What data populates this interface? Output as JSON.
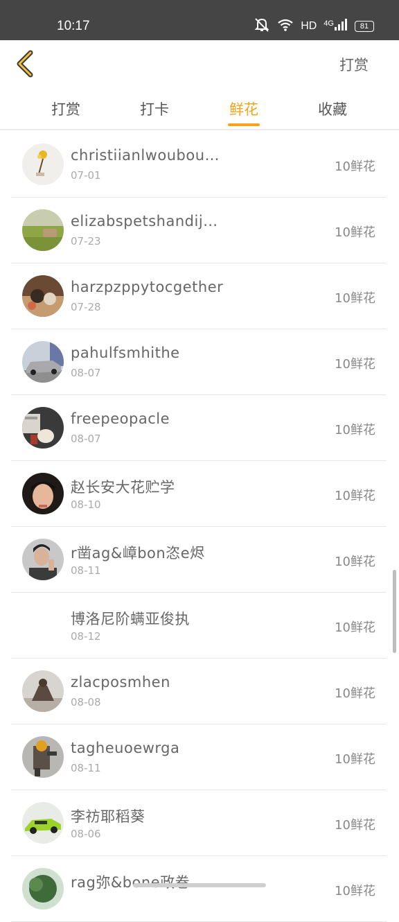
{
  "status_bar": {
    "time": "10:17",
    "hd": "HD",
    "network": "4G",
    "battery": "81"
  },
  "header": {
    "back_icon": "chevron-left-icon",
    "action_label": "打赏"
  },
  "tabs": [
    {
      "label": "打赏",
      "active": false
    },
    {
      "label": "打卡",
      "active": false
    },
    {
      "label": "鲜花",
      "active": true
    },
    {
      "label": "收藏",
      "active": false
    }
  ],
  "colors": {
    "accent": "#f2a51a",
    "status_bar": "#454545",
    "divider": "#e6e6e6"
  },
  "list": [
    {
      "name": "christiianlwoubou…",
      "date": "07-01",
      "amount": "10鲜花",
      "avatar": "flower-photo"
    },
    {
      "name": "elizabspetshandij…",
      "date": "07-23",
      "amount": "10鲜花",
      "avatar": "field-photo"
    },
    {
      "name": "harzpzppytocgether",
      "date": "07-28",
      "amount": "10鲜花",
      "avatar": "pets-photo"
    },
    {
      "name": "pahulfsmhithe",
      "date": "08-07",
      "amount": "10鲜花",
      "avatar": "car-photo"
    },
    {
      "name": "freepeopacle",
      "date": "08-07",
      "amount": "10鲜花",
      "avatar": "room-photo"
    },
    {
      "name": "赵长安大花贮学",
      "date": "08-10",
      "amount": "10鲜花",
      "avatar": "face-photo"
    },
    {
      "name": "r凿ag&嶂bon恣e烬",
      "date": "08-11",
      "amount": "10鲜花",
      "avatar": "man-photo"
    },
    {
      "name": "博洛尼阶螨亚俊执",
      "date": "08-12",
      "amount": "10鲜花",
      "avatar": "none"
    },
    {
      "name": "zlacposmhen",
      "date": "08-08",
      "amount": "10鲜花",
      "avatar": "pushup-photo"
    },
    {
      "name": "tagheuoewrga",
      "date": "08-11",
      "amount": "10鲜花",
      "avatar": "robot-photo"
    },
    {
      "name": "李祊耶稻葵",
      "date": "08-06",
      "amount": "10鲜花",
      "avatar": "sportscar-photo"
    },
    {
      "name": "rag弥&bone政卷",
      "date": "",
      "amount": "10鲜花",
      "avatar": "tree-photo"
    }
  ]
}
